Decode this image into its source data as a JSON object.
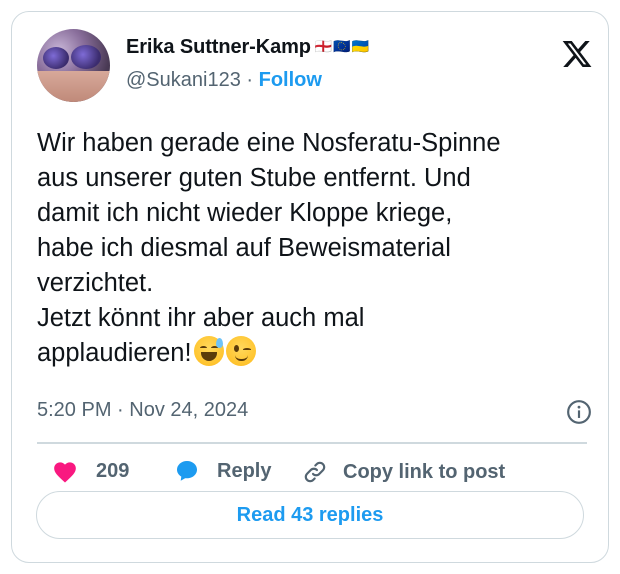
{
  "author": {
    "name": "Erika Suttner-Kamp",
    "name_flags": "🏴󠁧󠁢󠁥󠁮󠁧󠁿🇪🇺🇺🇦",
    "handle": "@Sukani123",
    "separator": "·",
    "follow_label": "Follow"
  },
  "tweet": {
    "text": "Wir haben gerade eine Nosferatu-Spinne\naus unserer guten Stube entfernt. Und\ndamit ich nicht wieder Kloppe kriege,\nhabe ich diesmal auf Beweismaterial\nverzichtet.\nJetzt könnt ihr aber auch mal\napplaudieren!",
    "emojis": [
      "grinning-face-with-sweat",
      "winking-face"
    ],
    "timestamp": "5:20 PM · Nov 24, 2024"
  },
  "actions": {
    "like_count": "209",
    "reply_label": "Reply",
    "copy_link_label": "Copy link to post"
  },
  "read_replies_label": "Read 43 replies",
  "icons": {
    "brand": "x-logo-icon",
    "info": "info-icon",
    "like": "heart-icon",
    "reply": "speech-bubble-icon",
    "copy": "link-icon"
  },
  "colors": {
    "accent": "#1d9bf0",
    "like": "#f91880",
    "text": "#0f1419",
    "muted": "#536471",
    "border": "#cfd9de"
  }
}
